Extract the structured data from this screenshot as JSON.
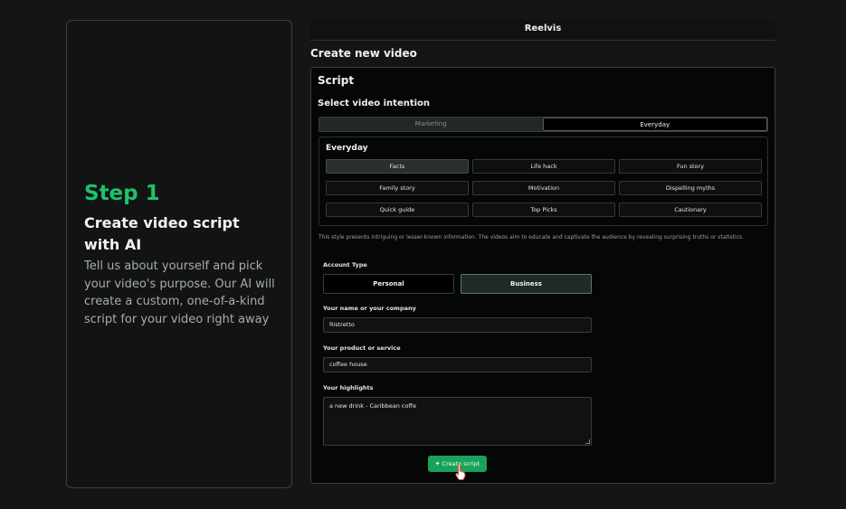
{
  "step": {
    "title": "Step 1",
    "heading": "Create video script with AI",
    "description": "Tell us about yourself and pick your video's purpose. Our AI will create a custom, one-of-a-kind script for your video right away"
  },
  "app": {
    "name": "Reelvis",
    "page_title": "Create new video"
  },
  "script": {
    "title": "Script",
    "intention_label": "Select video intention",
    "intentions": [
      {
        "label": "Marketing",
        "active": false
      },
      {
        "label": "Everyday",
        "active": true
      }
    ],
    "category_title": "Everyday",
    "styles": [
      {
        "label": "Facts",
        "active": true
      },
      {
        "label": "Life hack",
        "active": false
      },
      {
        "label": "Fun story",
        "active": false
      },
      {
        "label": "Family story",
        "active": false
      },
      {
        "label": "Motivation",
        "active": false
      },
      {
        "label": "Dispelling myths",
        "active": false
      },
      {
        "label": "Quick guide",
        "active": false
      },
      {
        "label": "Top Picks",
        "active": false
      },
      {
        "label": "Cautionary",
        "active": false
      }
    ],
    "style_description": "This style presents intriguing or lesser-known information. The videos aim to educate and captivate the audience by revealing surprising truths or statistics."
  },
  "form": {
    "account_type_label": "Account Type",
    "account_types": [
      {
        "label": "Personal",
        "active": false
      },
      {
        "label": "Business",
        "active": true
      }
    ],
    "name_label": "Your name or your company",
    "name_value": "Ristretto",
    "product_label": "Your product or service",
    "product_value": "coffee house",
    "highlights_label": "Your highlights",
    "highlights_value": "a new drink - Caribbean coffe",
    "create_button": "Create script"
  },
  "colors": {
    "accent": "#1fc16b",
    "button": "#1aa15c",
    "background": "#131615"
  }
}
